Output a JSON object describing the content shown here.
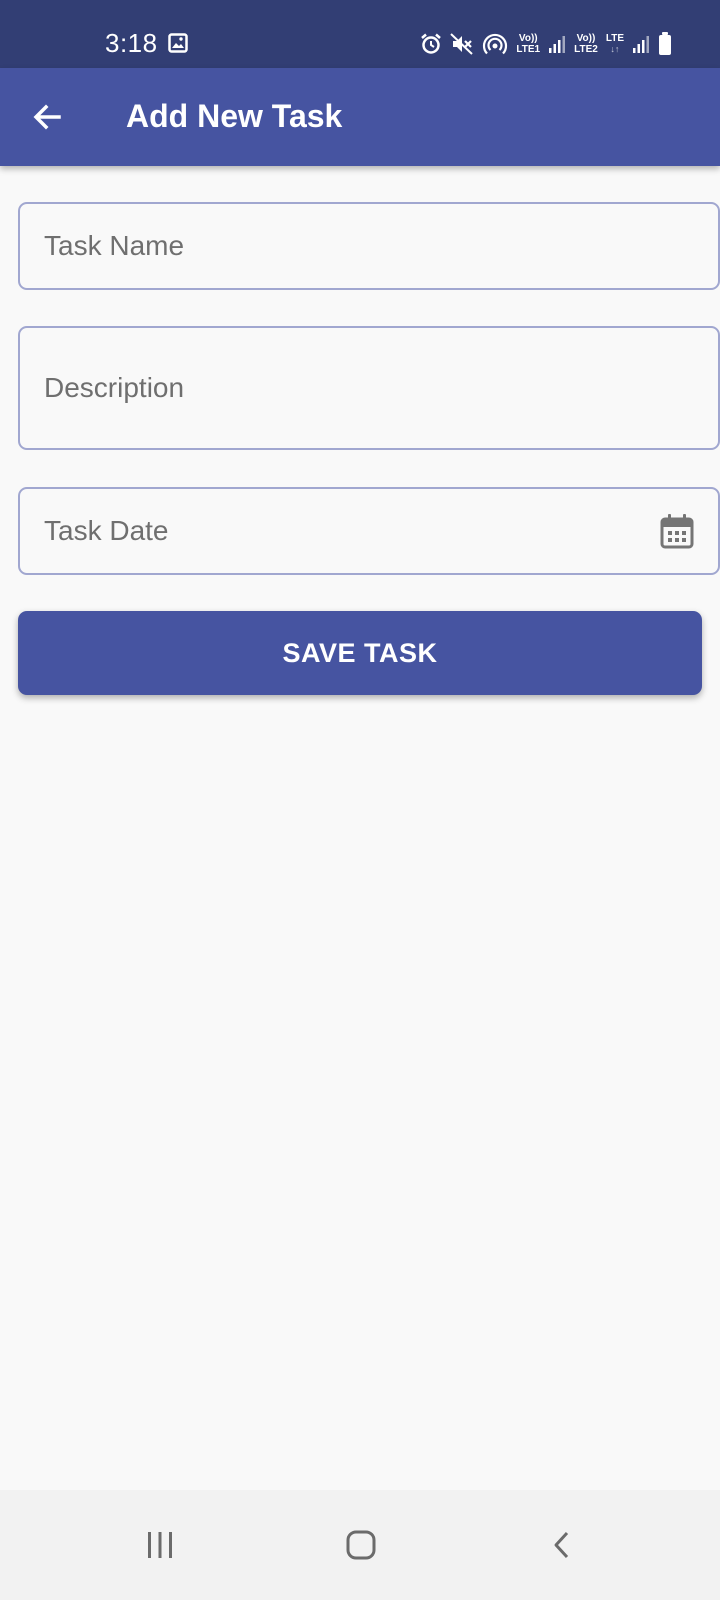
{
  "status_bar": {
    "time": "3:18",
    "icons": [
      "gallery-icon",
      "alarm-icon",
      "mute-icon",
      "hotspot-icon",
      "signal-icon",
      "battery-icon"
    ],
    "sim1_top": "Vo))",
    "sim1_bottom": "LTE1",
    "sim2_top": "Vo))",
    "sim2_bottom": "LTE2",
    "data_label": "LTE"
  },
  "app_bar": {
    "title": "Add New Task",
    "back_icon": "arrow-left-icon",
    "color": "#4654a1"
  },
  "form": {
    "task_name": {
      "value": "",
      "placeholder": "Task Name"
    },
    "description": {
      "value": "",
      "placeholder": "Description"
    },
    "task_date": {
      "value": "",
      "placeholder": "Task Date",
      "icon": "calendar-icon"
    },
    "save_label": "SAVE TASK"
  },
  "nav_bar": {
    "buttons": [
      "recent-apps-icon",
      "home-icon",
      "back-icon"
    ]
  },
  "colors": {
    "status_bar": "#323e74",
    "primary": "#4654a1",
    "field_border": "#a1a7d0",
    "background": "#f9f9f9"
  }
}
